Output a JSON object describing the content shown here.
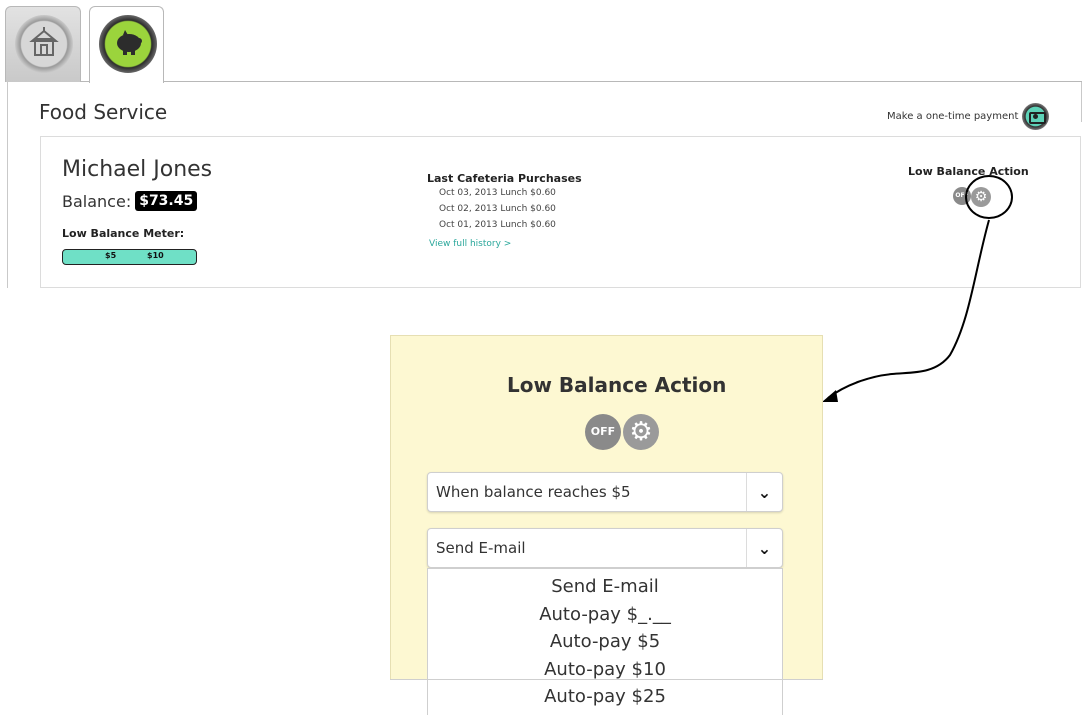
{
  "tabs": [
    {
      "name": "school",
      "icon": "school-icon",
      "active": false
    },
    {
      "name": "food-service",
      "icon": "piggy-bank-icon",
      "active": true
    }
  ],
  "header": {
    "title": "Food Service",
    "payment_link": "Make a one-time payment",
    "payment_icon": "money-icon"
  },
  "student": {
    "name": "Michael Jones",
    "balance_label": "Balance:",
    "balance_value": "$73.45",
    "meter_label": "Low Balance Meter:",
    "meter_ticks": [
      "$5",
      "$10"
    ]
  },
  "purchases": {
    "title": "Last Cafeteria Purchases",
    "items": [
      "Oct 03, 2013  Lunch  $0.60",
      "Oct 02, 2013  Lunch  $0.60",
      "Oct 01, 2013  Lunch  $0.60"
    ],
    "history_link": "View full history >"
  },
  "low_balance_action": {
    "title": "Low Balance Action",
    "off_label": "OFF",
    "threshold_select": "When balance reaches $5",
    "action_select": "Send E-mail",
    "action_options": [
      "Send E-mail",
      "Auto-pay $_.__",
      "Auto-pay $5",
      "Auto-pay $10",
      "Auto-pay $25"
    ]
  },
  "colors": {
    "meter_fill": "#6fe0c6",
    "panel_bg": "#fdf8d2",
    "food_tab_accent": "#9bd43c",
    "link": "#2aa79b"
  }
}
